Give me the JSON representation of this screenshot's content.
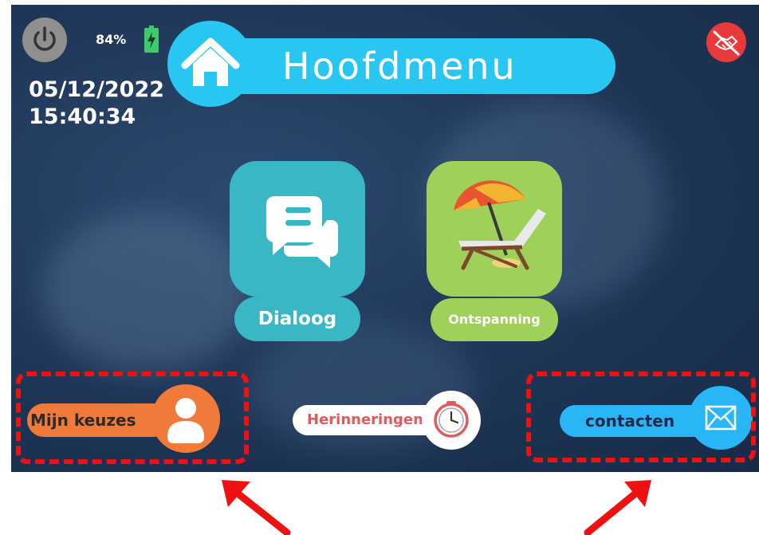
{
  "status": {
    "battery_percent": "84%",
    "date": "05/12/2022",
    "time": "15:40:34"
  },
  "header": {
    "title": "Hoofdmenu"
  },
  "menu": {
    "dialog_label": "Dialoog",
    "relax_label": "Ontspanning"
  },
  "bottom": {
    "choices_label": "Mijn keuzes",
    "reminders_label": "Herinneringen",
    "contacts_label": "contacten"
  },
  "colors": {
    "accent": "#29c6f2",
    "dialog": "#3ab7c4",
    "relax": "#9fd15a",
    "choices": "#f07a3a",
    "contacts": "#29b6f6",
    "highlight": "#ee1111"
  },
  "icons": [
    "power-icon",
    "battery-icon",
    "home-icon",
    "no-handshake-icon",
    "chat-icon",
    "beach-chair-icon",
    "person-icon",
    "clock-icon",
    "mail-icon",
    "arrow-icon"
  ]
}
